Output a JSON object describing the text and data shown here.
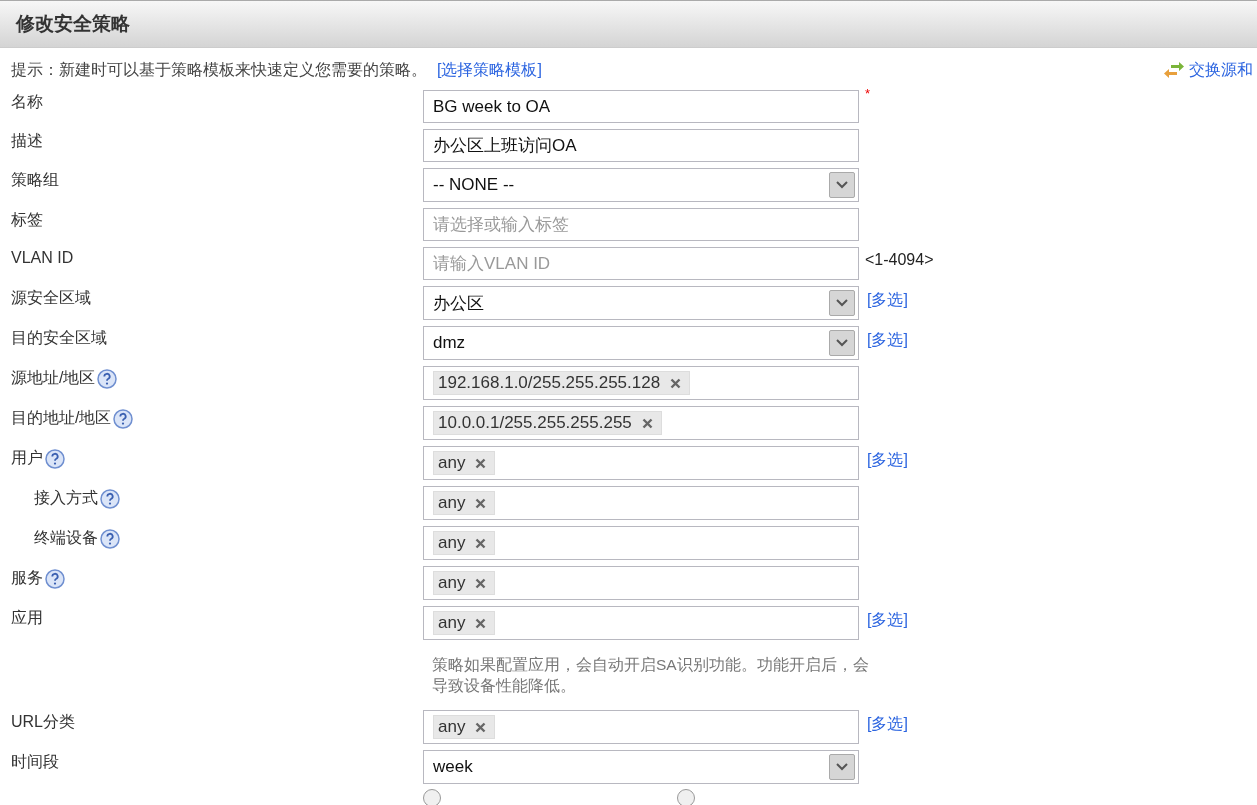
{
  "header": {
    "title": "修改安全策略"
  },
  "tip": {
    "text": "提示：新建时可以基于策略模板来快速定义您需要的策略。",
    "link": "[选择策略模板]"
  },
  "swap_link": "交换源和",
  "fields": [
    {
      "label": "名称",
      "kind": "text",
      "value": "BG week to OA",
      "required_mark": "*",
      "indent": false,
      "help": false
    },
    {
      "label": "描述",
      "kind": "text",
      "value": "办公区上班访问OA",
      "indent": false,
      "help": false
    },
    {
      "label": "策略组",
      "kind": "select",
      "value": "-- NONE --",
      "indent": false,
      "help": false
    },
    {
      "label": "标签",
      "kind": "text",
      "placeholder": "请选择或输入标签",
      "indent": false,
      "help": false
    },
    {
      "label": "VLAN ID",
      "kind": "text",
      "placeholder": "请输入VLAN ID",
      "suffix": "<1-4094>",
      "indent": false,
      "help": false
    },
    {
      "label": "源安全区域",
      "kind": "select",
      "value": "办公区",
      "link": "[多选]",
      "indent": false,
      "help": false
    },
    {
      "label": "目的安全区域",
      "kind": "select",
      "value": "dmz",
      "link": "[多选]",
      "indent": false,
      "help": false
    },
    {
      "label": "源地址/地区",
      "kind": "tags",
      "tags": [
        "192.168.1.0/255.255.255.128"
      ],
      "indent": false,
      "help": true
    },
    {
      "label": "目的地址/地区",
      "kind": "tags",
      "tags": [
        "10.0.0.1/255.255.255.255"
      ],
      "indent": false,
      "help": true
    },
    {
      "label": "用户",
      "kind": "tags",
      "tags": [
        "any"
      ],
      "link": "[多选]",
      "indent": false,
      "help": true
    },
    {
      "label": "接入方式",
      "kind": "tags",
      "tags": [
        "any"
      ],
      "indent": true,
      "help": true
    },
    {
      "label": "终端设备",
      "kind": "tags",
      "tags": [
        "any"
      ],
      "indent": true,
      "help": true
    },
    {
      "label": "服务",
      "kind": "tags",
      "tags": [
        "any"
      ],
      "indent": false,
      "help": true
    },
    {
      "label": "应用",
      "kind": "tags",
      "tags": [
        "any"
      ],
      "link": "[多选]",
      "note": "策略如果配置应用，会自动开启SA识别功能。功能开启后，会导致设备性能降低。",
      "indent": false,
      "help": false
    },
    {
      "label": "URL分类",
      "kind": "tags",
      "tags": [
        "any"
      ],
      "link": "[多选]",
      "indent": false,
      "help": false
    },
    {
      "label": "时间段",
      "kind": "select",
      "value": "week",
      "indent": false,
      "help": false
    }
  ],
  "time_radios": [
    {
      "selected": false
    },
    {
      "selected": false
    }
  ]
}
